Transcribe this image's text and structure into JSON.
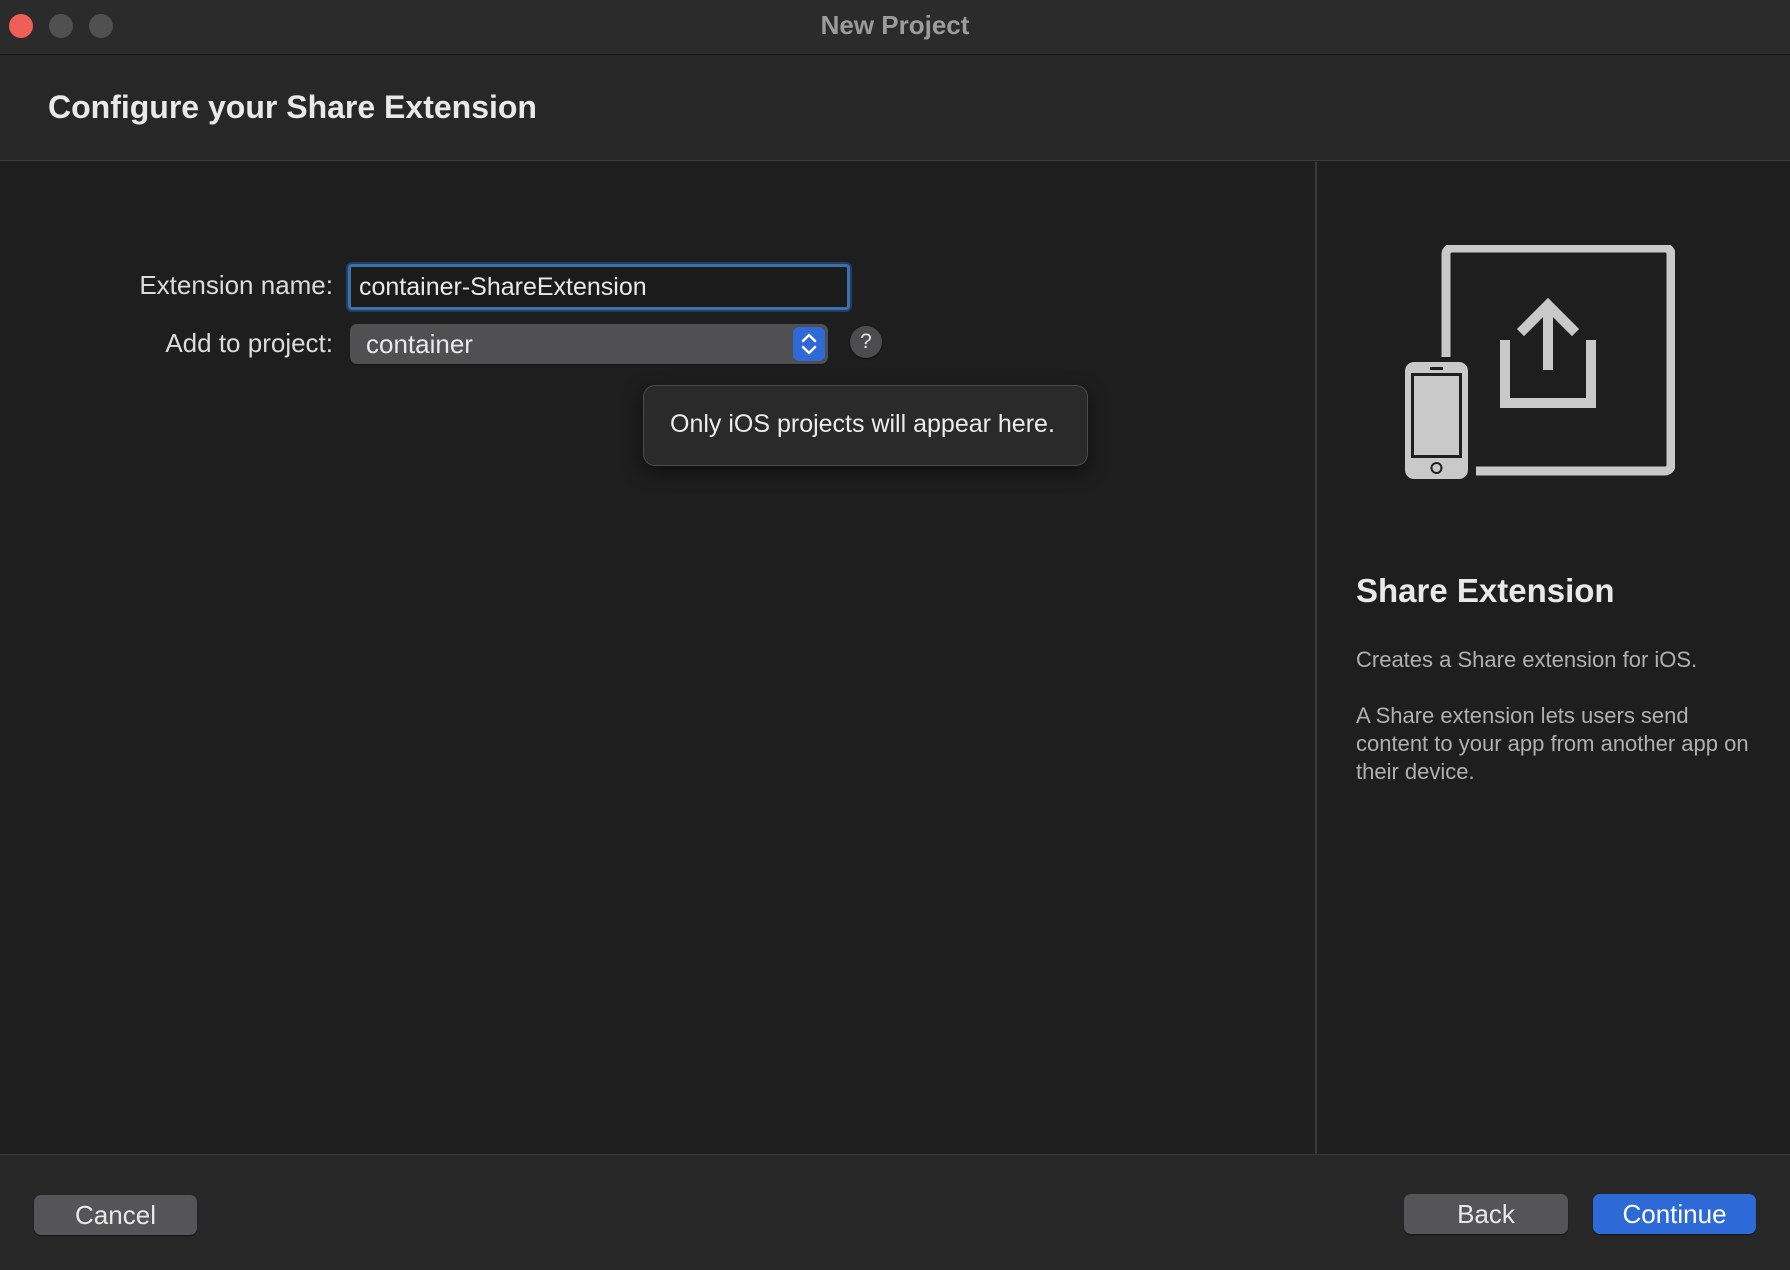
{
  "window": {
    "title": "New Project"
  },
  "header": {
    "title": "Configure your Share Extension"
  },
  "form": {
    "extension_name_label": "Extension name:",
    "extension_name_value": "container-ShareExtension",
    "add_to_project_label": "Add to project:",
    "add_to_project_value": "container",
    "help_glyph": "?",
    "help_popover_text": "Only iOS projects will appear here."
  },
  "sidebar": {
    "icon": "share-extension-device-icon",
    "title": "Share Extension",
    "description_short": "Creates a Share extension for iOS.",
    "description_long": "A Share extension lets users send content to your app from another app on their device."
  },
  "footer": {
    "cancel_label": "Cancel",
    "back_label": "Back",
    "continue_label": "Continue"
  },
  "colors": {
    "accent": "#2d6ad8",
    "close_button": "#ee5f57",
    "background": "#1e1e1f"
  }
}
